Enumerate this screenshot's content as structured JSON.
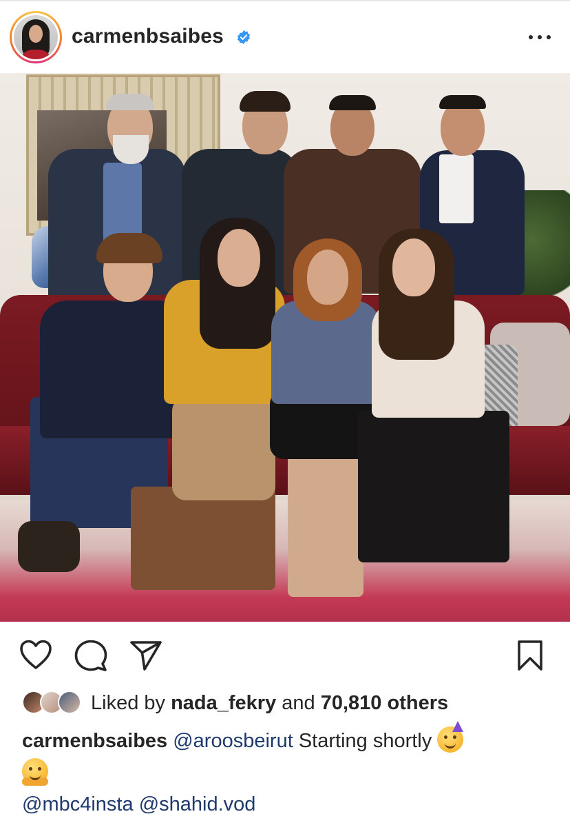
{
  "header": {
    "username": "carmenbsaibes",
    "verified": true,
    "avatar_icon": "profile-avatar",
    "more_icon": "more-horizontal-icon"
  },
  "photo": {
    "alt_kind": "group-photo"
  },
  "actions": {
    "like_icon": "heart-icon",
    "comment_icon": "comment-icon",
    "share_icon": "send-icon",
    "save_icon": "bookmark-icon"
  },
  "likes": {
    "prefix": "Liked by ",
    "user": "nada_fekry",
    "middle": " and ",
    "count": "70,810 others"
  },
  "caption": {
    "username": "carmenbsaibes",
    "mention1": "@aroosbeirut",
    "text": " Starting shortly ",
    "emoji1": "partying-face-emoji",
    "emoji2": "hugging-face-emoji",
    "mention2": "@mbc4insta",
    "mention3": "@shahid.vod"
  },
  "colors": {
    "text": "#262626",
    "mention": "#1e3a6e",
    "verified": "#3897f0",
    "story_ring_start": "#f9c94e",
    "story_ring_end": "#dd2a7b"
  }
}
